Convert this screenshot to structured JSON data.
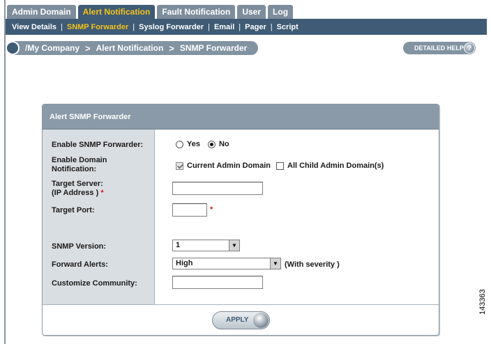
{
  "tabs": [
    {
      "label": "Admin Domain",
      "active": false
    },
    {
      "label": "Alert Notification",
      "active": true
    },
    {
      "label": "Fault Notification",
      "active": false
    },
    {
      "label": "User",
      "active": false
    },
    {
      "label": "Log",
      "active": false
    }
  ],
  "subnav": {
    "view_details": "View Details",
    "snmp_forwarder": "SNMP Forwarder",
    "syslog_forwarder": "Syslog Forwarder",
    "email": "Email",
    "pager": "Pager",
    "script": "Script",
    "separator": "|"
  },
  "breadcrumb": {
    "root": "/My Company",
    "level1": "Alert Notification",
    "level2": "SNMP Forwarder",
    "separator": ">"
  },
  "help": {
    "label": "DETAILED HELP",
    "icon": "?"
  },
  "panel": {
    "title": "Alert SNMP Forwarder",
    "enable_label": "Enable SNMP Forwarder:",
    "enable_yes": "Yes",
    "enable_no": "No",
    "enable_value": "No",
    "domain_label_1": "Enable  Domain",
    "domain_label_2": "Notification:",
    "current_admin": "Current Admin Domain",
    "current_admin_checked": true,
    "child_admin": "All Child Admin Domain(s)",
    "child_admin_checked": false,
    "target_server_label_1": "Target Server:",
    "target_server_label_2": "(IP Address )",
    "required_mark": "*",
    "target_server_value": "",
    "target_port_label": "Target Port:",
    "target_port_value": "",
    "snmp_version_label": "SNMP Version:",
    "snmp_version_value": "1",
    "forward_alerts_label": "Forward Alerts:",
    "forward_alerts_value": "High",
    "with_severity": "(With severity )",
    "community_label": "Customize Community:",
    "community_value": "",
    "apply_label": "APPLY"
  },
  "figure_id": "143363",
  "colors": {
    "nav_dark": "#3f5b75",
    "tab_inactive": "#7d8d9c",
    "active_text": "#f2c31c",
    "panel_header": "#8a9aa8",
    "label_col": "#d9dee3",
    "required": "#d21818"
  }
}
